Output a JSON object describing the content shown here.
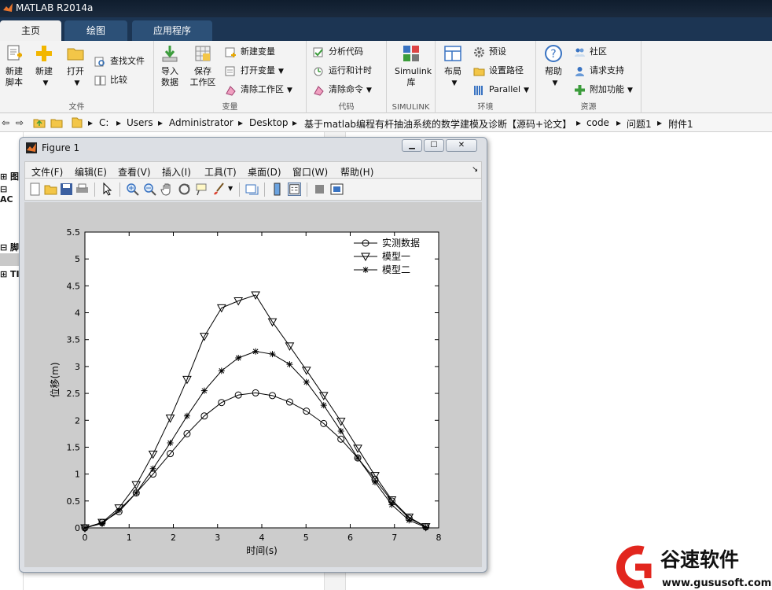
{
  "app": {
    "title": "MATLAB R2014a"
  },
  "tabs": [
    {
      "label": "主页",
      "active": true
    },
    {
      "label": "绘图",
      "active": false
    },
    {
      "label": "应用程序",
      "active": false
    }
  ],
  "ribbon": {
    "groups": {
      "file": "文件",
      "variable": "变量",
      "code": "代码",
      "simulink": "SIMULINK",
      "environment": "环境",
      "resources": "资源"
    },
    "new_script": "新建\n脚本",
    "new_script_l1": "新建",
    "new_script_l2": "脚本",
    "new": "新建",
    "open": "打开",
    "find_files": "查找文件",
    "compare": "比较",
    "import_l1": "导入",
    "import_l2": "数据",
    "save_ws_l1": "保存",
    "save_ws_l2": "工作区",
    "new_var": "新建变量",
    "open_var": "打开变量",
    "clear_ws": "清除工作区",
    "analyze_code": "分析代码",
    "run_time": "运行和计时",
    "clear_cmd": "清除命令",
    "simulink_l1": "Simulink",
    "simulink_l2": "库",
    "layout": "布局",
    "preferences": "预设",
    "set_path": "设置路径",
    "parallel": "Parallel",
    "help": "帮助",
    "community": "社区",
    "request_support": "请求支持",
    "addons": "附加功能"
  },
  "address": {
    "crumbs": [
      "C:",
      "Users",
      "Administrator",
      "Desktop",
      "基于matlab编程有杆抽油系统的数学建模及诊断【源码+论文】",
      "code",
      "问题1",
      "附件1"
    ]
  },
  "left_panel": {
    "items": [
      "图",
      "AC",
      "脚",
      "TI"
    ]
  },
  "figure": {
    "title": "Figure 1",
    "menu": [
      "文件(F)",
      "编辑(E)",
      "查看(V)",
      "插入(I)",
      "工具(T)",
      "桌面(D)",
      "窗口(W)",
      "帮助(H)"
    ]
  },
  "chart_data": {
    "type": "line",
    "xlabel": "时间(s)",
    "ylabel": "位移(m)",
    "xlim": [
      0,
      8
    ],
    "ylim": [
      0,
      5.5
    ],
    "xticks": [
      0,
      1,
      2,
      3,
      4,
      5,
      6,
      7,
      8
    ],
    "yticks": [
      0,
      0.5,
      1,
      1.5,
      2,
      2.5,
      3,
      3.5,
      4,
      4.5,
      5,
      5.5
    ],
    "grid": false,
    "legend_position": "top-right",
    "x": [
      0,
      0.39,
      0.77,
      1.16,
      1.54,
      1.93,
      2.31,
      2.7,
      3.09,
      3.47,
      3.86,
      4.24,
      4.63,
      5.01,
      5.4,
      5.79,
      6.17,
      6.56,
      6.94,
      7.33,
      7.71
    ],
    "series": [
      {
        "name": "实测数据",
        "marker": "circle",
        "values": [
          0,
          0.1,
          0.3,
          0.65,
          1.0,
          1.38,
          1.75,
          2.08,
          2.33,
          2.47,
          2.51,
          2.46,
          2.34,
          2.17,
          1.94,
          1.65,
          1.3,
          0.9,
          0.5,
          0.18,
          0.02
        ]
      },
      {
        "name": "模型一",
        "marker": "triangle-down",
        "values": [
          0,
          0.1,
          0.37,
          0.8,
          1.37,
          2.04,
          2.76,
          3.56,
          4.09,
          4.22,
          4.33,
          3.83,
          3.38,
          2.93,
          2.46,
          1.98,
          1.48,
          0.97,
          0.52,
          0.2,
          0.02
        ]
      },
      {
        "name": "模型二",
        "marker": "star",
        "values": [
          0,
          0.08,
          0.33,
          0.65,
          1.1,
          1.58,
          2.08,
          2.55,
          2.92,
          3.16,
          3.28,
          3.23,
          3.04,
          2.71,
          2.28,
          1.8,
          1.3,
          0.85,
          0.43,
          0.14,
          0.01
        ]
      }
    ]
  },
  "watermark": {
    "brand": "谷速软件",
    "url": "www.gususoft.com"
  }
}
